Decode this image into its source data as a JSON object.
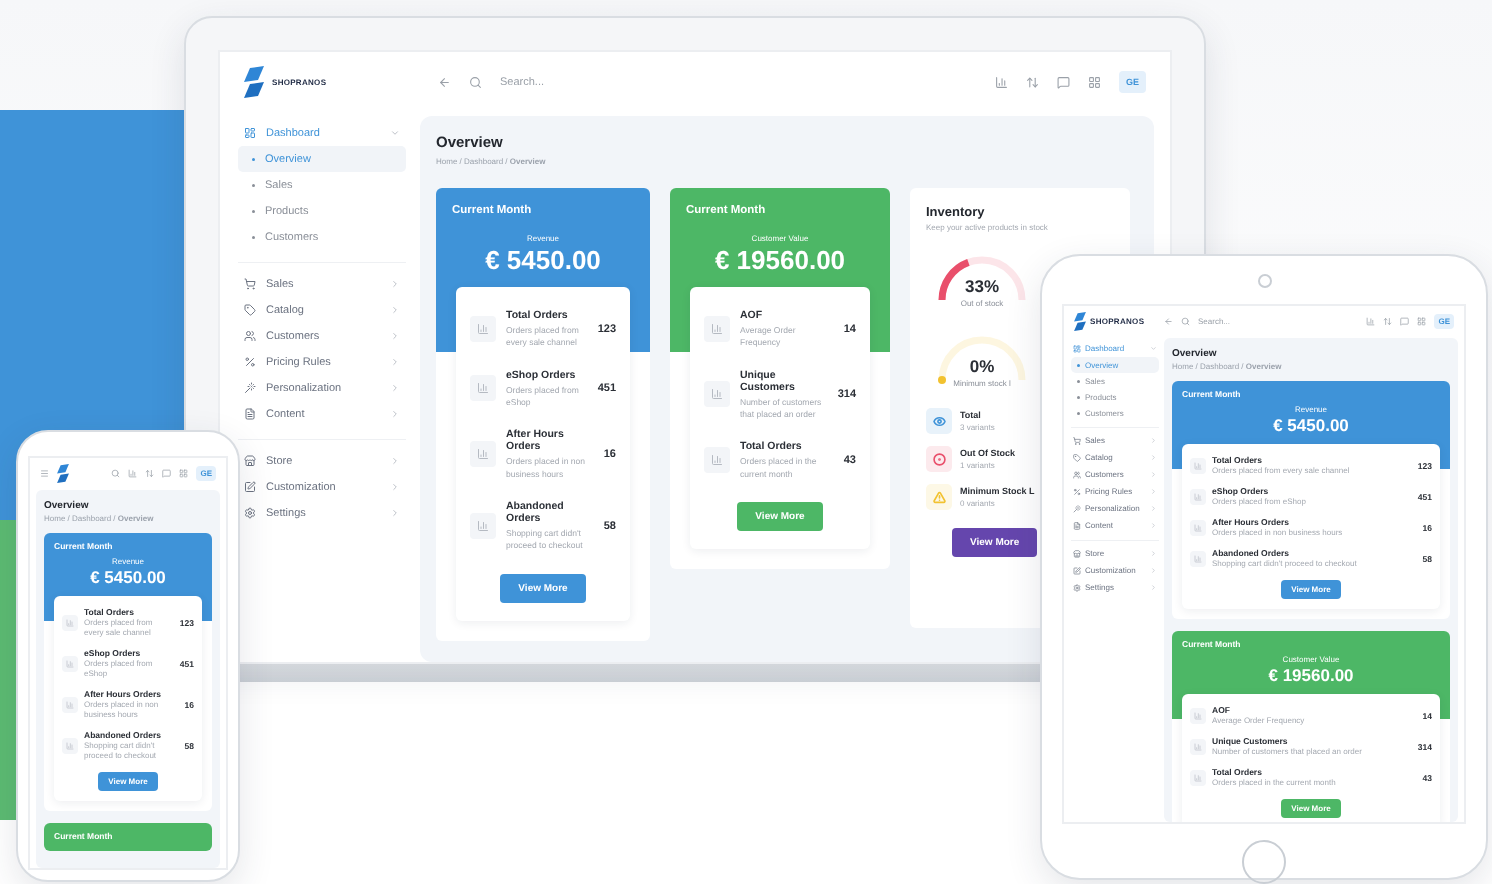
{
  "laptop": {
    "logo": "SHOPRANOS",
    "search_placeholder": "Search...",
    "user_badge": "GE",
    "sidebar": {
      "groups": [
        [
          {
            "label": "Dashboard",
            "expanded": true,
            "children": [
              {
                "label": "Overview",
                "selected": true
              },
              {
                "label": "Sales",
                "selected": false
              },
              {
                "label": "Products",
                "selected": false
              },
              {
                "label": "Customers",
                "selected": false
              }
            ]
          }
        ],
        [
          {
            "label": "Sales",
            "expanded": false
          },
          {
            "label": "Catalog",
            "expanded": false
          },
          {
            "label": "Customers",
            "expanded": false
          },
          {
            "label": "Pricing Rules",
            "expanded": false
          },
          {
            "label": "Personalization",
            "expanded": false
          },
          {
            "label": "Content",
            "expanded": false
          }
        ],
        [
          {
            "label": "Store",
            "expanded": false
          },
          {
            "label": "Customization",
            "expanded": false
          },
          {
            "label": "Settings",
            "expanded": false
          }
        ]
      ]
    },
    "page_title": "Overview",
    "breadcrumb": "Home / Dashboard / **Overview**",
    "cards": [
      {
        "title": "Current Month",
        "caption": "Revenue",
        "amount": "€ 5450.00",
        "color": "#3f93d8",
        "button": "View More",
        "stats": [
          {
            "title": "Total Orders",
            "description": "Orders placed from every sale channel",
            "value": "123"
          },
          {
            "title": "eShop Orders",
            "description": "Orders placed from eShop",
            "value": "451"
          },
          {
            "title": "After Hours Orders",
            "description": "Orders placed in non business hours",
            "value": "16"
          },
          {
            "title": "Abandoned Orders",
            "description": "Shopping cart didn't proceed to checkout",
            "value": "58"
          }
        ]
      },
      {
        "title": "Current Month",
        "caption": "Customer Value",
        "amount": "€ 19560.00",
        "color": "#4db766",
        "button": "View More",
        "stats": [
          {
            "title": "AOF",
            "description": "Average Order Frequency",
            "value": "14"
          },
          {
            "title": "Unique Customers",
            "description": "Number of customers that placed an order",
            "value": "314"
          },
          {
            "title": "Total Orders",
            "description": "Orders placed in the current month",
            "value": "43"
          }
        ]
      }
    ],
    "inventory": {
      "title": "Inventory",
      "subtitle": "Keep your active products in stock",
      "gauges": [
        {
          "reading": "33%",
          "label": "Out of stock",
          "level": 0.33,
          "color": "#e94f6b"
        },
        {
          "reading": "0%",
          "label": "Minimum stock l",
          "level": 0,
          "color": "#f2c230"
        }
      ],
      "legend": [
        {
          "title": "Total",
          "detail": "3 variants",
          "color": "#3f93d8"
        },
        {
          "title": "Out Of Stock",
          "detail": "1 variants",
          "color": "#e94f6b"
        },
        {
          "title": "Minimum Stock L",
          "detail": "0 variants",
          "color": "#f2c230"
        }
      ],
      "button": "View More"
    }
  },
  "tablet": {
    "logo": "SHOPRANOS",
    "search_placeholder": "Search...",
    "user_badge": "GE",
    "sidebar": {
      "groups": [
        [
          {
            "label": "Dashboard",
            "expanded": true,
            "children": [
              {
                "label": "Overview",
                "selected": true
              },
              {
                "label": "Sales",
                "selected": false
              },
              {
                "label": "Products",
                "selected": false
              },
              {
                "label": "Customers",
                "selected": false
              }
            ]
          }
        ],
        [
          {
            "label": "Sales",
            "expanded": false
          },
          {
            "label": "Catalog",
            "expanded": false
          },
          {
            "label": "Customers",
            "expanded": false
          },
          {
            "label": "Pricing Rules",
            "expanded": false
          },
          {
            "label": "Personalization",
            "expanded": false
          },
          {
            "label": "Content",
            "expanded": false
          }
        ],
        [
          {
            "label": "Store",
            "expanded": false
          },
          {
            "label": "Customization",
            "expanded": false
          },
          {
            "label": "Settings",
            "expanded": false
          }
        ]
      ]
    },
    "page_title": "Overview",
    "breadcrumb": "Home / Dashboard / **Overview**",
    "cards": [
      {
        "title": "Current Month",
        "caption": "Revenue",
        "amount": "€ 5450.00",
        "color": "#3f93d8",
        "button": "View More",
        "stats": [
          {
            "title": "Total Orders",
            "description": "Orders placed from every sale channel",
            "value": "123"
          },
          {
            "title": "eShop Orders",
            "description": "Orders placed from eShop",
            "value": "451"
          },
          {
            "title": "After Hours Orders",
            "description": "Orders placed in non business hours",
            "value": "16"
          },
          {
            "title": "Abandoned Orders",
            "description": "Shopping cart didn't proceed to checkout",
            "value": "58"
          }
        ]
      },
      {
        "title": "Current Month",
        "caption": "Customer Value",
        "amount": "€ 19560.00",
        "color": "#4db766",
        "button": "View More",
        "stats": [
          {
            "title": "AOF",
            "description": "Average Order Frequency",
            "value": "14"
          },
          {
            "title": "Unique Customers",
            "description": "Number of customers that placed an order",
            "value": "314"
          },
          {
            "title": "Total Orders",
            "description": "Orders placed in the current month",
            "value": "43"
          }
        ]
      }
    ]
  },
  "phone": {
    "user_badge": "GE",
    "page_title": "Overview",
    "breadcrumb": "Home / Dashboard / **Overview**",
    "cards": [
      {
        "title": "Current Month",
        "caption": "Revenue",
        "amount": "€ 5450.00",
        "color": "#3f93d8",
        "button": "View More",
        "stats": [
          {
            "title": "Total Orders",
            "description": "Orders placed from every sale channel",
            "value": "123"
          },
          {
            "title": "eShop Orders",
            "description": "Orders placed from eShop",
            "value": "451"
          },
          {
            "title": "After Hours Orders",
            "description": "Orders placed in non business hours",
            "value": "16"
          },
          {
            "title": "Abandoned Orders",
            "description": "Shopping cart didn't proceed to checkout",
            "value": "58"
          }
        ]
      },
      {
        "title": "Current Month",
        "color": "#4db766"
      }
    ]
  }
}
